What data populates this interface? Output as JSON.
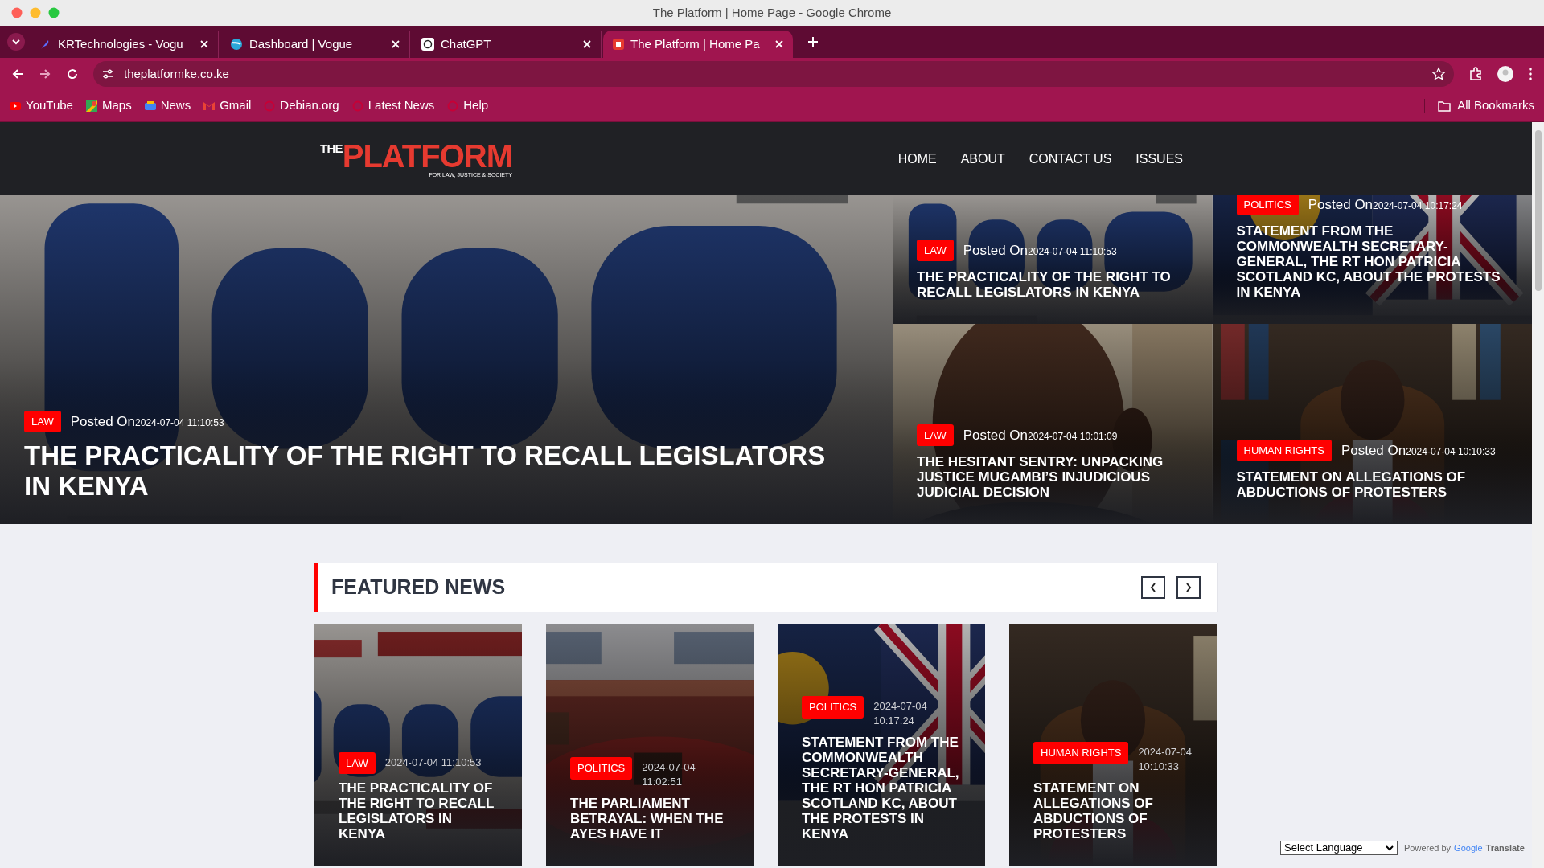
{
  "window": {
    "title": "The Platform | Home Page - Google Chrome"
  },
  "tabs": [
    {
      "title": "KRTechnologies - Vogu",
      "selected": false
    },
    {
      "title": "Dashboard | Vogue",
      "selected": false
    },
    {
      "title": "ChatGPT",
      "selected": false
    },
    {
      "title": "The Platform | Home Pa",
      "selected": true
    }
  ],
  "address": "theplatformke.co.ke",
  "bookmarks": [
    {
      "label": "YouTube"
    },
    {
      "label": "Maps"
    },
    {
      "label": "News"
    },
    {
      "label": "Gmail"
    },
    {
      "label": "Debian.org"
    },
    {
      "label": "Latest News"
    },
    {
      "label": "Help"
    }
  ],
  "all_bookmarks": "All Bookmarks",
  "site": {
    "logo_the": "THE",
    "logo_name": "PLATFORM",
    "logo_tagline": "FOR LAW, JUSTICE & SOCIETY",
    "nav": [
      {
        "label": "HOME"
      },
      {
        "label": "ABOUT"
      },
      {
        "label": "CONTACT US"
      },
      {
        "label": "ISSUES"
      }
    ]
  },
  "hero": {
    "main": {
      "category": "LAW",
      "posted_label": "Posted On",
      "date": "2024-07-04 11:10:53",
      "title": "THE PRACTICALITY OF THE RIGHT TO RECALL LEGISLATORS IN KENYA"
    },
    "side": [
      {
        "category": "LAW",
        "posted_label": "Posted On",
        "date": "2024-07-04 11:10:53",
        "title": "THE PRACTICALITY OF THE RIGHT TO RECALL LEGISLATORS IN KENYA"
      },
      {
        "category": "POLITICS",
        "posted_label": "Posted On",
        "date": "2024-07-04 10:17:24",
        "title": "STATEMENT FROM THE COMMONWEALTH SECRETARY-GENERAL, THE RT HON PATRICIA SCOTLAND KC, ABOUT THE PROTESTS IN KENYA"
      },
      {
        "category": "LAW",
        "posted_label": "Posted On",
        "date": "2024-07-04 10:01:09",
        "title": "THE HESITANT SENTRY: UNPACKING JUSTICE MUGAMBI’S INJUDICIOUS JUDICIAL DECISION"
      },
      {
        "category": "HUMAN RIGHTS",
        "posted_label": "Posted On",
        "date": "2024-07-04 10:10:33",
        "title": "STATEMENT ON ALLEGATIONS OF ABDUCTIONS OF PROTESTERS"
      }
    ]
  },
  "featured": {
    "title": "FEATURED NEWS",
    "cards": [
      {
        "category": "LAW",
        "date": "2024-07-04 11:10:53",
        "title": "THE PRACTICALITY OF THE RIGHT TO RECALL LEGISLATORS IN KENYA"
      },
      {
        "category": "POLITICS",
        "date": "2024-07-04 11:02:51",
        "title": "THE PARLIAMENT BETRAYAL: WHEN THE AYES HAVE IT"
      },
      {
        "category": "POLITICS",
        "date": "2024-07-04 10:17:24",
        "title": "STATEMENT FROM THE COMMONWEALTH SECRETARY-GENERAL, THE RT HON PATRICIA SCOTLAND KC, ABOUT THE PROTESTS IN KENYA"
      },
      {
        "category": "HUMAN RIGHTS",
        "date": "2024-07-04 10:10:33",
        "title": "STATEMENT ON ALLEGATIONS OF ABDUCTIONS OF PROTESTERS"
      }
    ]
  },
  "translate": {
    "select": "Select Language",
    "powered_by": "Powered by",
    "google": "Google",
    "product": "Translate"
  }
}
